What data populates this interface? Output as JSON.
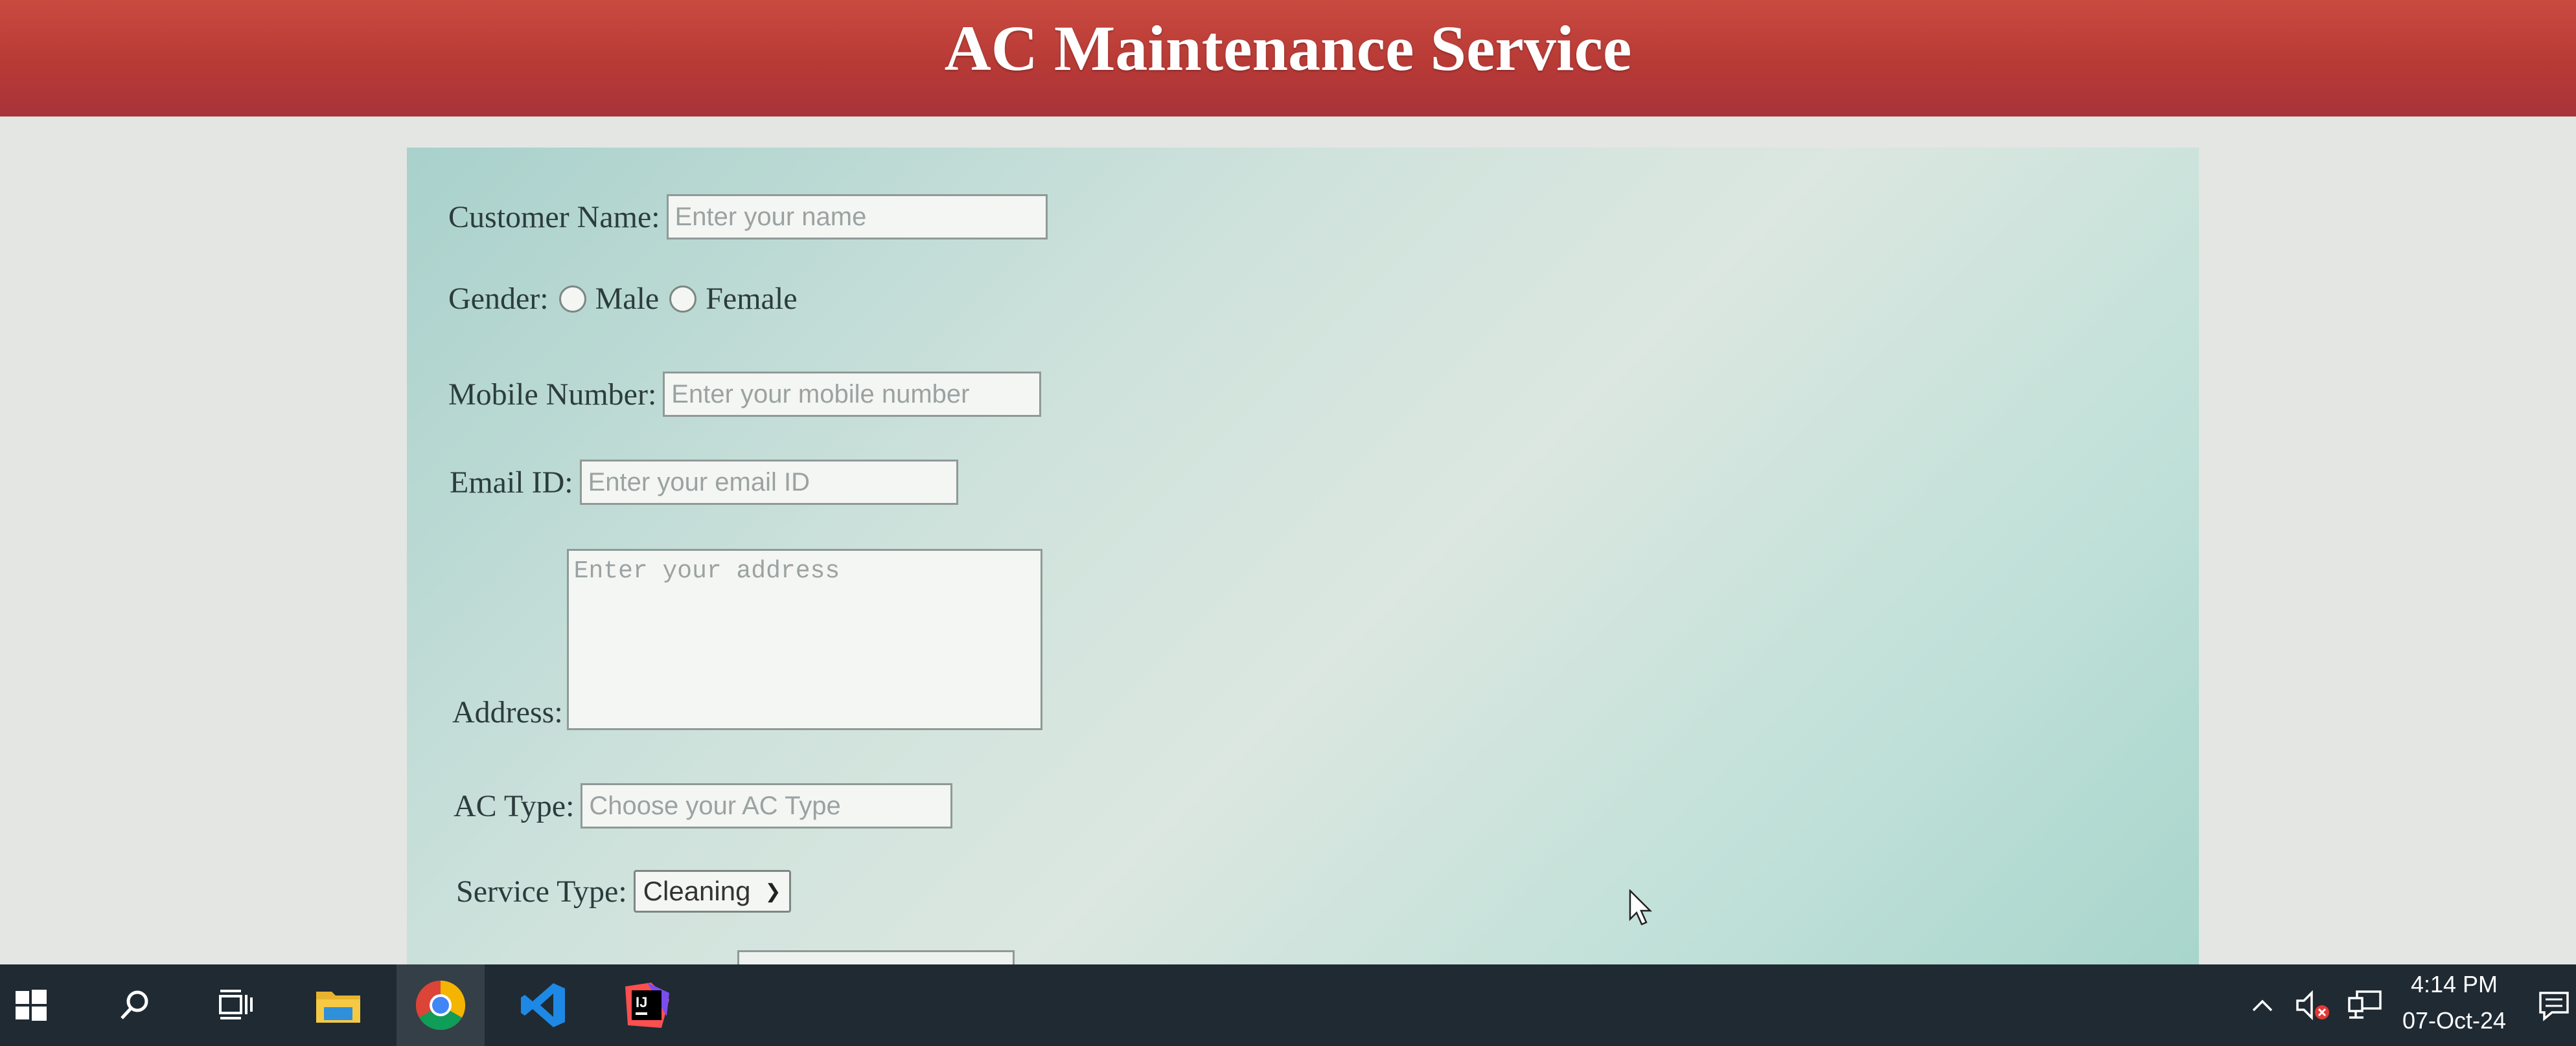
{
  "header": {
    "title": "AC Maintenance Service"
  },
  "form": {
    "customer_name": {
      "label": "Customer Name:",
      "placeholder": "Enter your name"
    },
    "gender": {
      "label": "Gender:",
      "options": [
        "Male",
        "Female"
      ]
    },
    "mobile": {
      "label": "Mobile Number:",
      "placeholder": "Enter your mobile number"
    },
    "email": {
      "label": "Email ID:",
      "placeholder": "Enter your email ID"
    },
    "address": {
      "label": "Address:",
      "placeholder": "Enter your address"
    },
    "ac_type": {
      "label": "AC Type:",
      "placeholder": "Choose your AC Type"
    },
    "service_type": {
      "label": "Service Type:",
      "selected": "Cleaning"
    }
  },
  "taskbar": {
    "icons": [
      "windows-start-icon",
      "search-icon",
      "task-view-icon",
      "file-explorer-icon",
      "chrome-icon",
      "vscode-icon",
      "intellij-icon"
    ],
    "tray": {
      "icons": [
        "chevron-up-icon",
        "volume-muted-icon",
        "network-icon",
        "notification-icon"
      ],
      "time": "4:14 PM",
      "date": "07-Oct-24"
    }
  },
  "colors": {
    "header_bg": "#b83a36",
    "card_bg": "#c5ded7",
    "taskbar_bg": "#1f2a33"
  }
}
